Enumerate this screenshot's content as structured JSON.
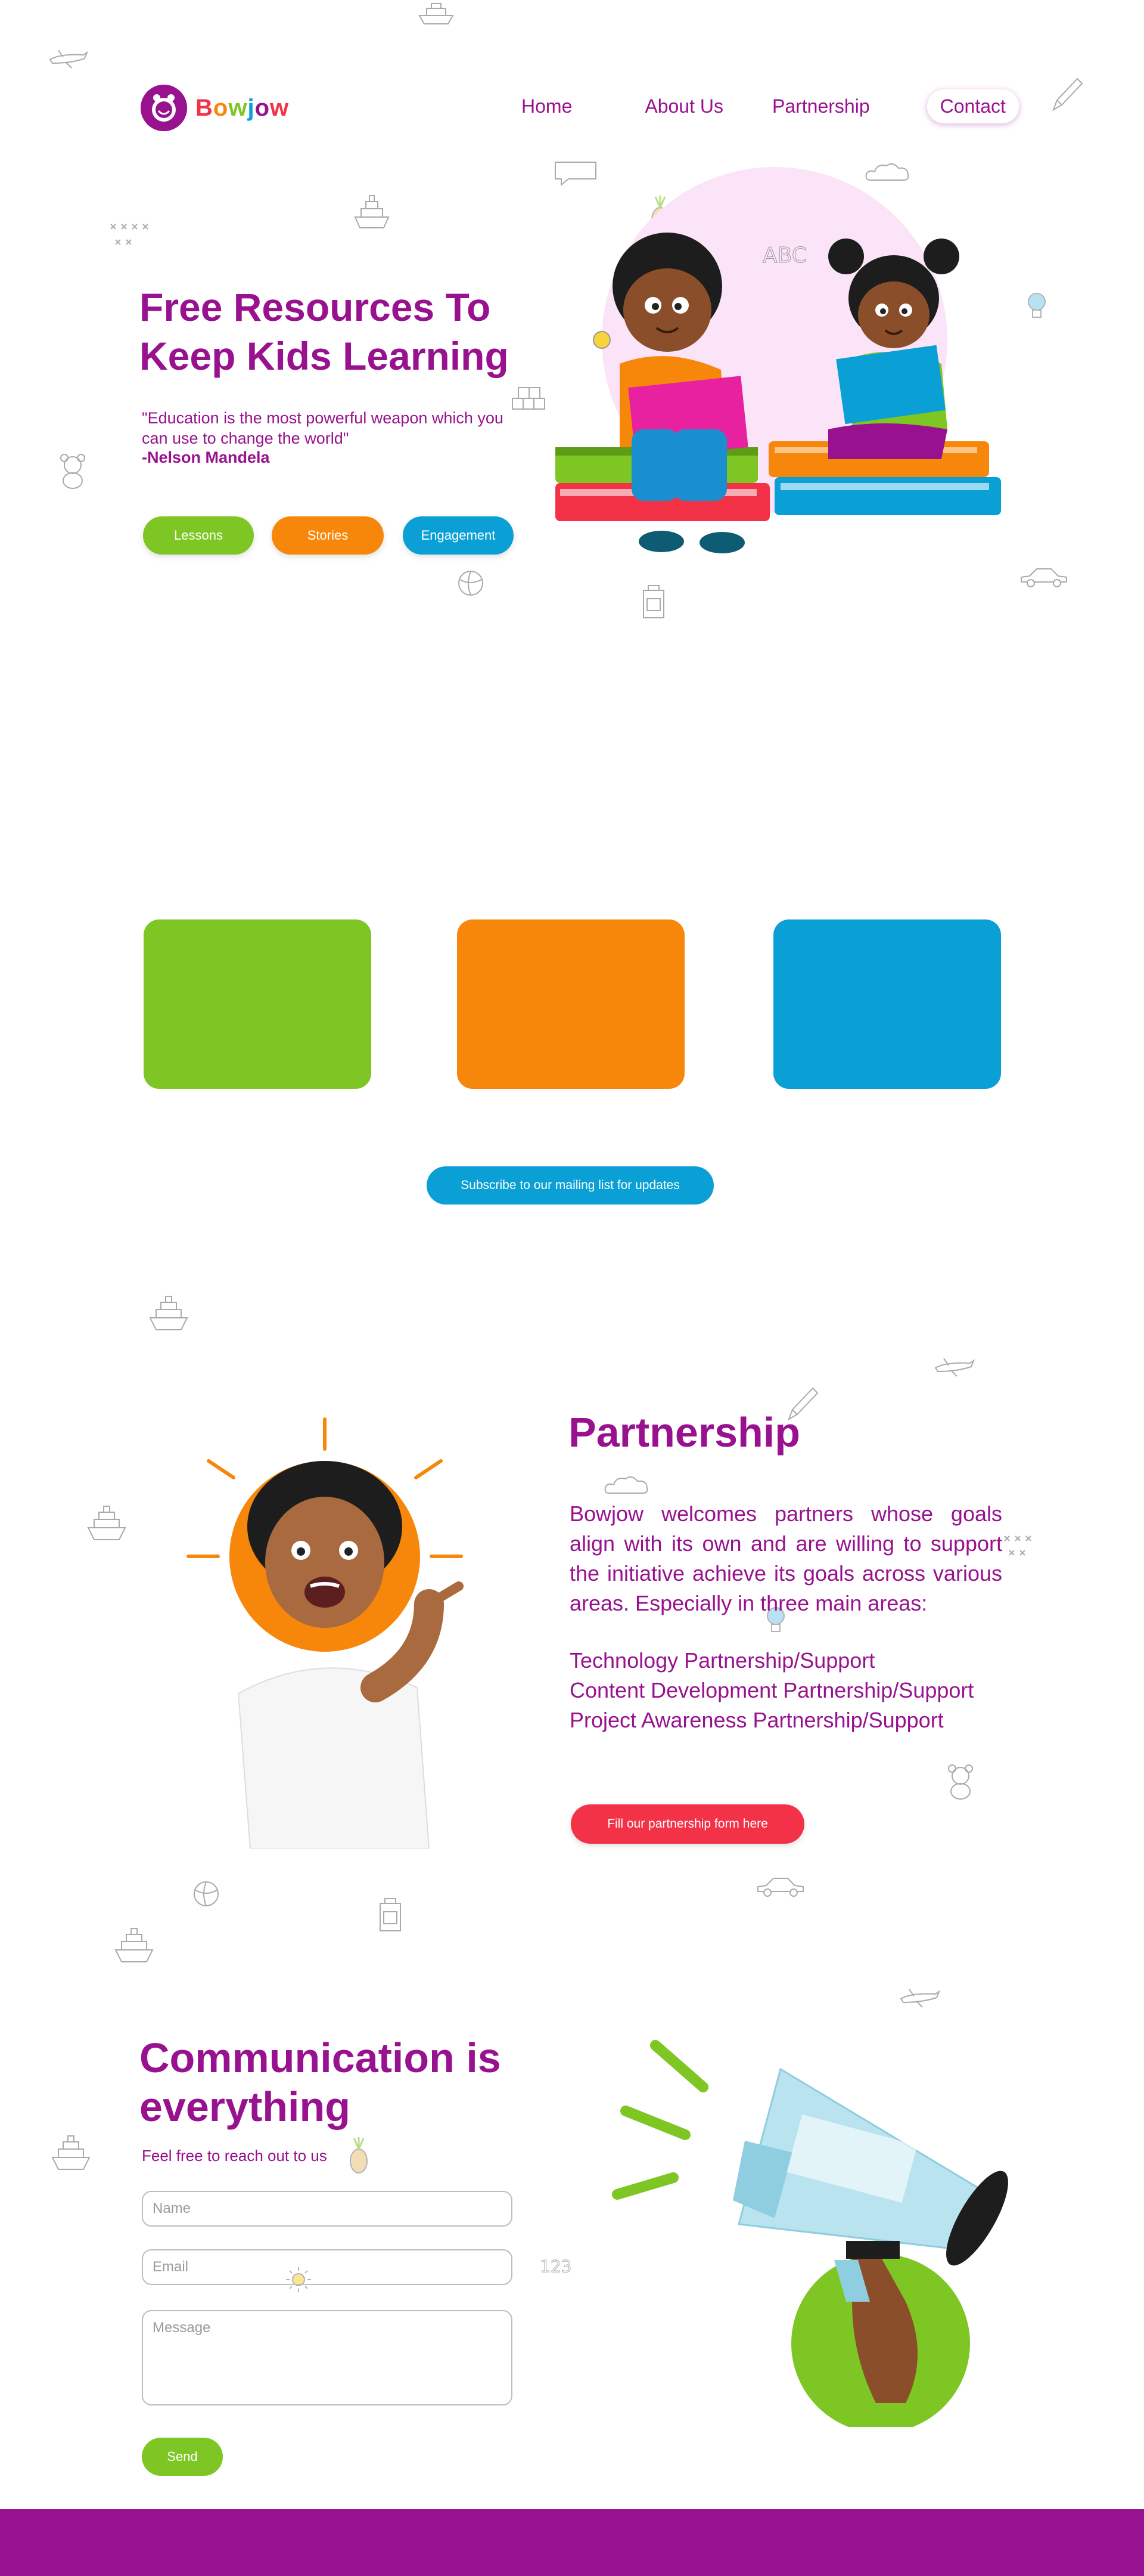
{
  "brand": {
    "name": "Bowjow",
    "letter_colors": [
      "#f33147",
      "#f7870a",
      "#7dc624",
      "#0aa0d5",
      "#98118e",
      "#f33147"
    ],
    "primary_color": "#98118e"
  },
  "nav": {
    "items": [
      "Home",
      "About Us",
      "Partnership"
    ],
    "contact_label": "Contact"
  },
  "hero": {
    "title": "Free Resources To Keep Kids Learning",
    "quote": "\"Education is the most powerful weapon which you can use to change the world\"",
    "author": "-Nelson Mandela",
    "buttons": [
      "Lessons",
      "Stories",
      "Engagement"
    ],
    "illustration_icon": "kids-reading-books-illustration"
  },
  "cards": {
    "colors": [
      "#7dc624",
      "#f7870a",
      "#0aa0d5"
    ],
    "subscribe_label": "Subscribe to our mailing list for updates"
  },
  "partnership": {
    "title": "Partnership",
    "intro": "Bowjow welcomes partners whose goals align with its own and are willing to support the initiative achieve its goals across various areas. Especially in three main areas:",
    "areas": [
      "Technology Partnership/Support",
      "Content Development Partnership/Support",
      "Project Awareness Partnership/Support"
    ],
    "button_label": "Fill our partnership form here",
    "button_color": "#f33147",
    "illustration_icon": "excited-child-pointing-image"
  },
  "communication": {
    "title": "Communication is everything",
    "subtitle": "Feel free to reach out to us",
    "name_placeholder": "Name",
    "email_placeholder": "Email",
    "message_placeholder": "Message",
    "send_label": "Send",
    "illustration_icon": "megaphone-hand-illustration"
  },
  "doodles": [
    "ship-icon",
    "plane-icon",
    "car-icon",
    "ball-icon",
    "teddy-icon",
    "pencil-icon",
    "cloud-icon",
    "pineapple-icon",
    "bulb-icon",
    "sun-icon",
    "abc-icon",
    "numbers-icon",
    "fun-icon",
    "crosses-icon",
    "blocks-icon",
    "bag-icon"
  ]
}
